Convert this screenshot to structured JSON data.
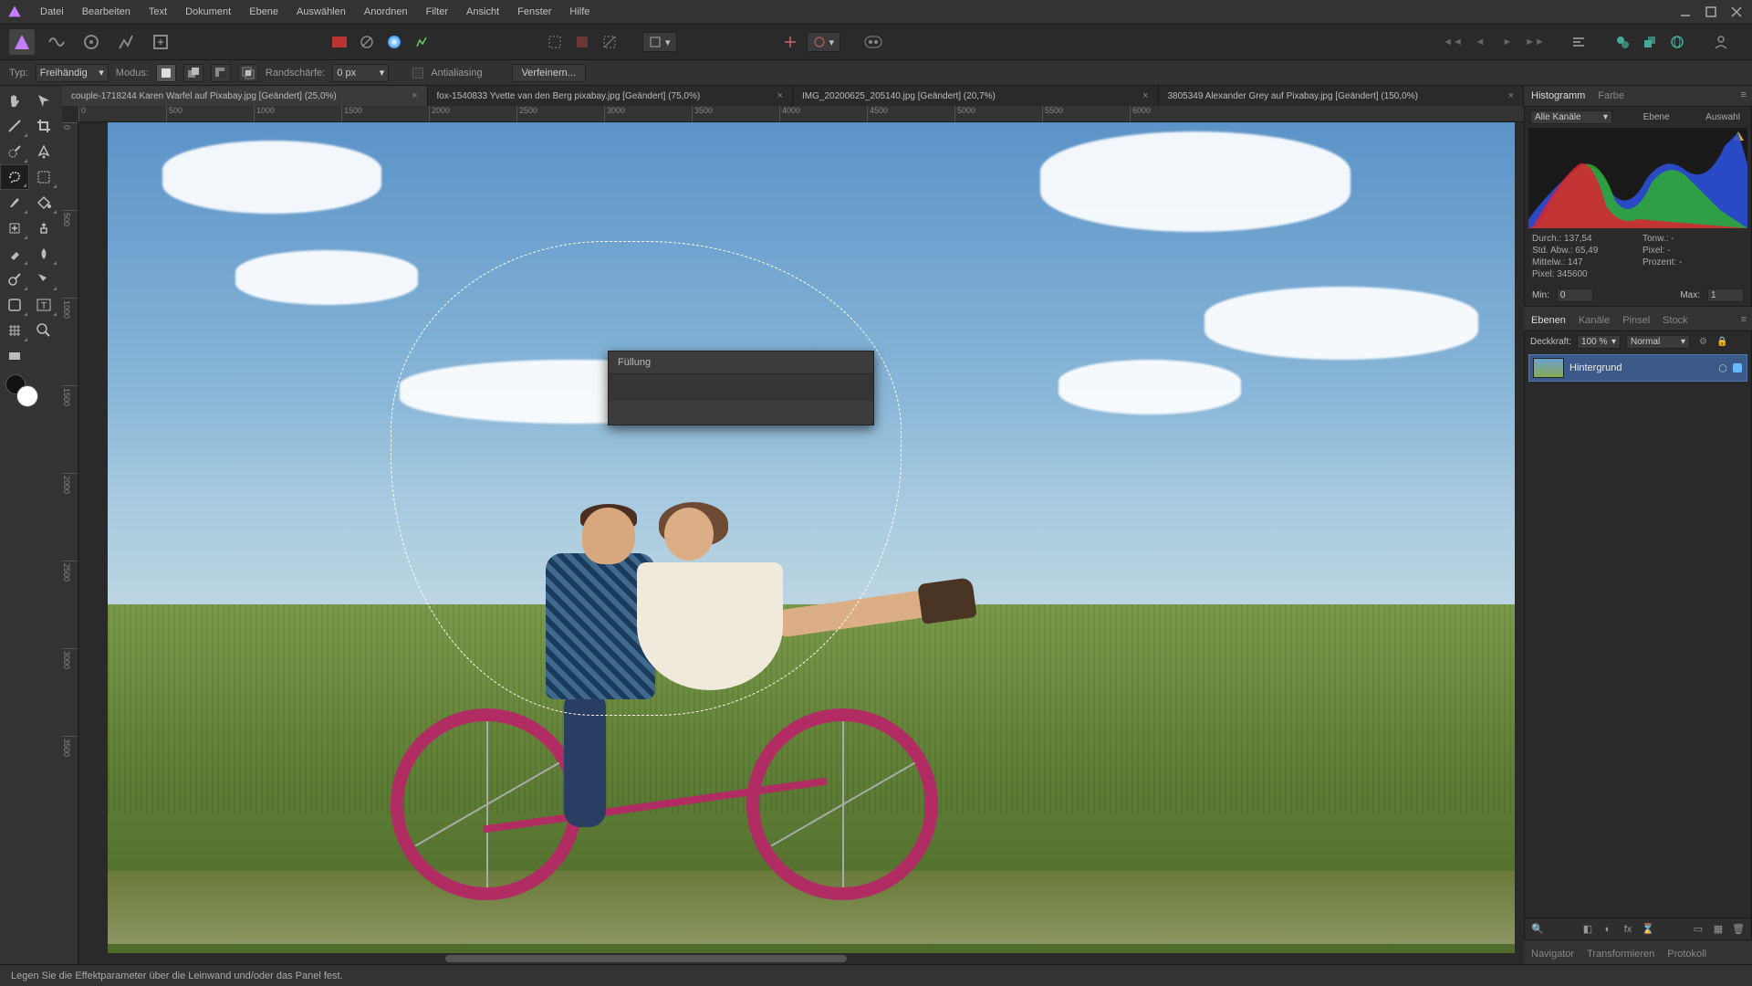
{
  "menu": [
    "Datei",
    "Bearbeiten",
    "Text",
    "Dokument",
    "Ebene",
    "Auswählen",
    "Anordnen",
    "Filter",
    "Ansicht",
    "Fenster",
    "Hilfe"
  ],
  "context": {
    "type_label": "Typ:",
    "type_value": "Freihändig",
    "mode_label": "Modus:",
    "feather_label": "Randschärfe:",
    "feather_value": "0 px",
    "antialias_label": "Antialiasing",
    "refine_label": "Verfeinern..."
  },
  "tabs": [
    {
      "label": "couple-1718244 Karen Warfel auf Pixabay.jpg [Geändert] (25,0%)",
      "active": true
    },
    {
      "label": "fox-1540833 Yvette van den Berg pixabay.jpg [Geändert] (75,0%)",
      "active": false
    },
    {
      "label": "IMG_20200625_205140.jpg [Geändert] (20,7%)",
      "active": false
    },
    {
      "label": "3805349 Alexander Grey auf Pixabay.jpg [Geändert] (150,0%)",
      "active": false
    }
  ],
  "ruler_h": [
    "0",
    "500",
    "1000",
    "1500",
    "2000",
    "2500",
    "3000",
    "3500",
    "4000",
    "4500",
    "5000",
    "5500",
    "6000"
  ],
  "ruler_v": [
    "0",
    "500",
    "1000",
    "1500",
    "2000",
    "2500",
    "3000",
    "3500"
  ],
  "fill_panel": {
    "title": "Füllung"
  },
  "right": {
    "hist_tabs": [
      "Histogramm",
      "Farbe"
    ],
    "hist_channel": "Alle Kanäle",
    "hist_source_tabs": [
      "Ebene",
      "Auswahl"
    ],
    "stats": {
      "avg_label": "Durch.:",
      "avg": "137,54",
      "std_label": "Std. Abw.:",
      "std": "65,49",
      "median_label": "Mittelw.:",
      "median": "147",
      "pixels_label": "Pixel:",
      "pixels": "345600",
      "tone_label": "Tonw.:",
      "tone": "-",
      "pixval_label": "Pixel:",
      "pixval": "-",
      "pct_label": "Prozent:",
      "pct": "-"
    },
    "min_label": "Min:",
    "min": "0",
    "max_label": "Max:",
    "max": "1",
    "layer_tabs": [
      "Ebenen",
      "Kanäle",
      "Pinsel",
      "Stock"
    ],
    "opacity_label": "Deckkraft:",
    "opacity": "100 %",
    "blend": "Normal",
    "layer0": "Hintergrund",
    "nav_tabs": [
      "Navigator",
      "Transformieren",
      "Protokoll"
    ]
  },
  "status": "Legen Sie die Effektparameter über die Leinwand und/oder das Panel fest."
}
